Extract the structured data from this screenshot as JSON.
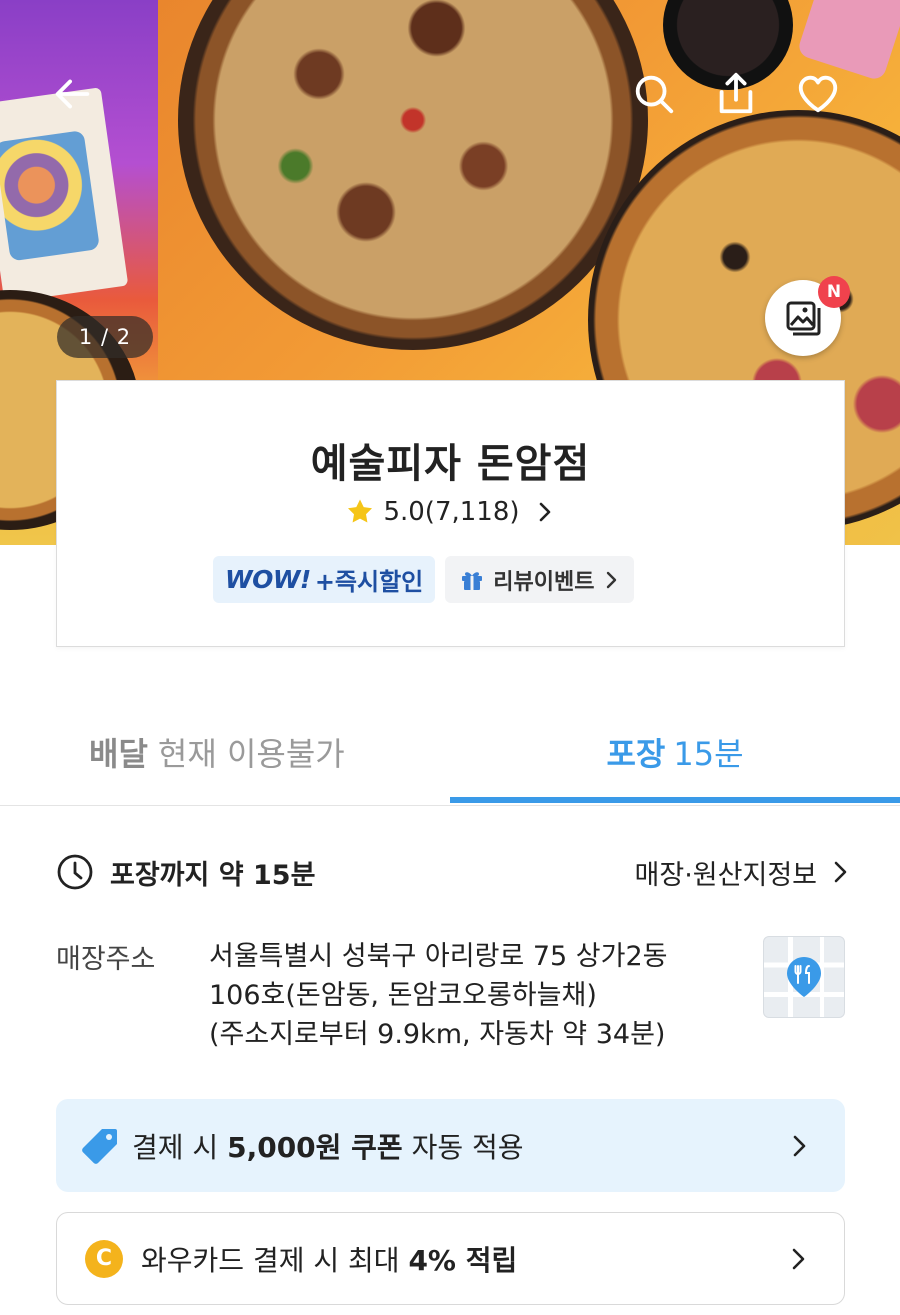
{
  "hero": {
    "photo_counter": "1 / 2",
    "new_badge": "N",
    "icons": [
      "back-arrow-icon",
      "search-icon",
      "share-icon",
      "heart-icon",
      "photo-gallery-icon"
    ]
  },
  "store": {
    "name": "예술피자 돈암점",
    "rating": "5.0(7,118)",
    "badges": {
      "wow": "WOW!",
      "wow_suffix": "+즉시할인",
      "review_event": "리뷰이벤트"
    }
  },
  "tabs": {
    "delivery": {
      "label": "배달",
      "status": "현재 이용불가"
    },
    "pickup": {
      "label": "포장",
      "time": "15분"
    },
    "active": "pickup"
  },
  "info": {
    "pickup_time": "포장까지 약 15분",
    "store_info_link": "매장·원산지정보",
    "address_label": "매장주소",
    "address_lines": [
      "서울특별시 성북구 아리랑로 75 상가2동",
      "106호(돈암동, 돈암코오롱하늘채)",
      "(주소지로부터 9.9km, 자동차 약 34분)"
    ]
  },
  "promos": {
    "coupon": {
      "prefix": "결제 시 ",
      "amount": "5,000원 쿠폰",
      "suffix": " 자동 적용"
    },
    "card": {
      "coin_letter": "C",
      "prefix": "와우카드 결제 시 최대 ",
      "rate": "4% 적립"
    }
  },
  "colors": {
    "accent": "#3a9ae8",
    "wow_text": "#1e4fa2",
    "coupon_bg": "#e6f3fd",
    "badge_red": "#f0424d",
    "coin": "#f4b31c",
    "star": "#f5c518"
  }
}
